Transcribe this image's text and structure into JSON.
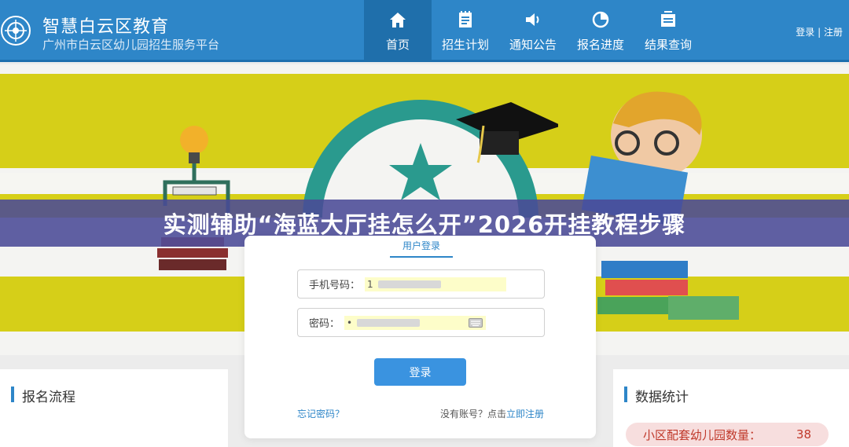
{
  "header": {
    "title": "智慧白云区教育",
    "subtitle": "广州市白云区幼儿园招生服务平台",
    "nav": [
      {
        "label": "首页",
        "icon": "home-icon",
        "active": true
      },
      {
        "label": "招生计划",
        "icon": "document-list-icon",
        "active": false
      },
      {
        "label": "通知公告",
        "icon": "speaker-icon",
        "active": false
      },
      {
        "label": "报名进度",
        "icon": "pie-chart-icon",
        "active": false
      },
      {
        "label": "结果查询",
        "icon": "inbox-icon",
        "active": false
      }
    ],
    "login_link": "登录",
    "separator": "|",
    "register_link": "注册"
  },
  "overlay": {
    "title": "实测辅助“海蓝大厅挂怎么开”2026开挂教程步骤"
  },
  "login": {
    "heading": "用户登录",
    "phone_label": "手机号码：",
    "phone_value": "1",
    "password_label": "密码：",
    "password_value": "•",
    "submit_label": "登录",
    "forgot_label": "忘记密码？",
    "no_account_text": "没有账号？点击",
    "register_label": "立即注册"
  },
  "panels": {
    "left_title": "报名流程",
    "right_title": "数据统计",
    "stat_label": "小区配套幼儿园数量：",
    "stat_value": "38"
  },
  "colors": {
    "header_blue": "#2e86c8",
    "banner_yellow": "#d6cf18",
    "overlay_purple": "#4a4a96",
    "button_blue": "#3a93e0"
  }
}
